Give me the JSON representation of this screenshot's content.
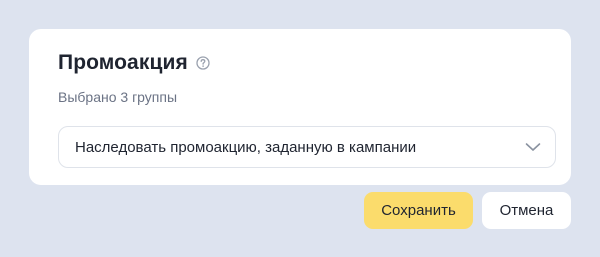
{
  "dialog": {
    "title": "Промоакция",
    "help_icon": "question-circle-icon",
    "subtitle": "Выбрано 3 группы"
  },
  "promo_select": {
    "selected_value": "Наследовать промоакцию, заданную в кампании",
    "icon": "chevron-down-icon"
  },
  "actions": {
    "save_label": "Сохранить",
    "cancel_label": "Отмена"
  },
  "colors": {
    "page_background": "#dde3ef",
    "card_background": "#ffffff",
    "primary_button": "#fbdc6c",
    "text_primary": "#1f2430",
    "text_secondary": "#6b7385"
  }
}
